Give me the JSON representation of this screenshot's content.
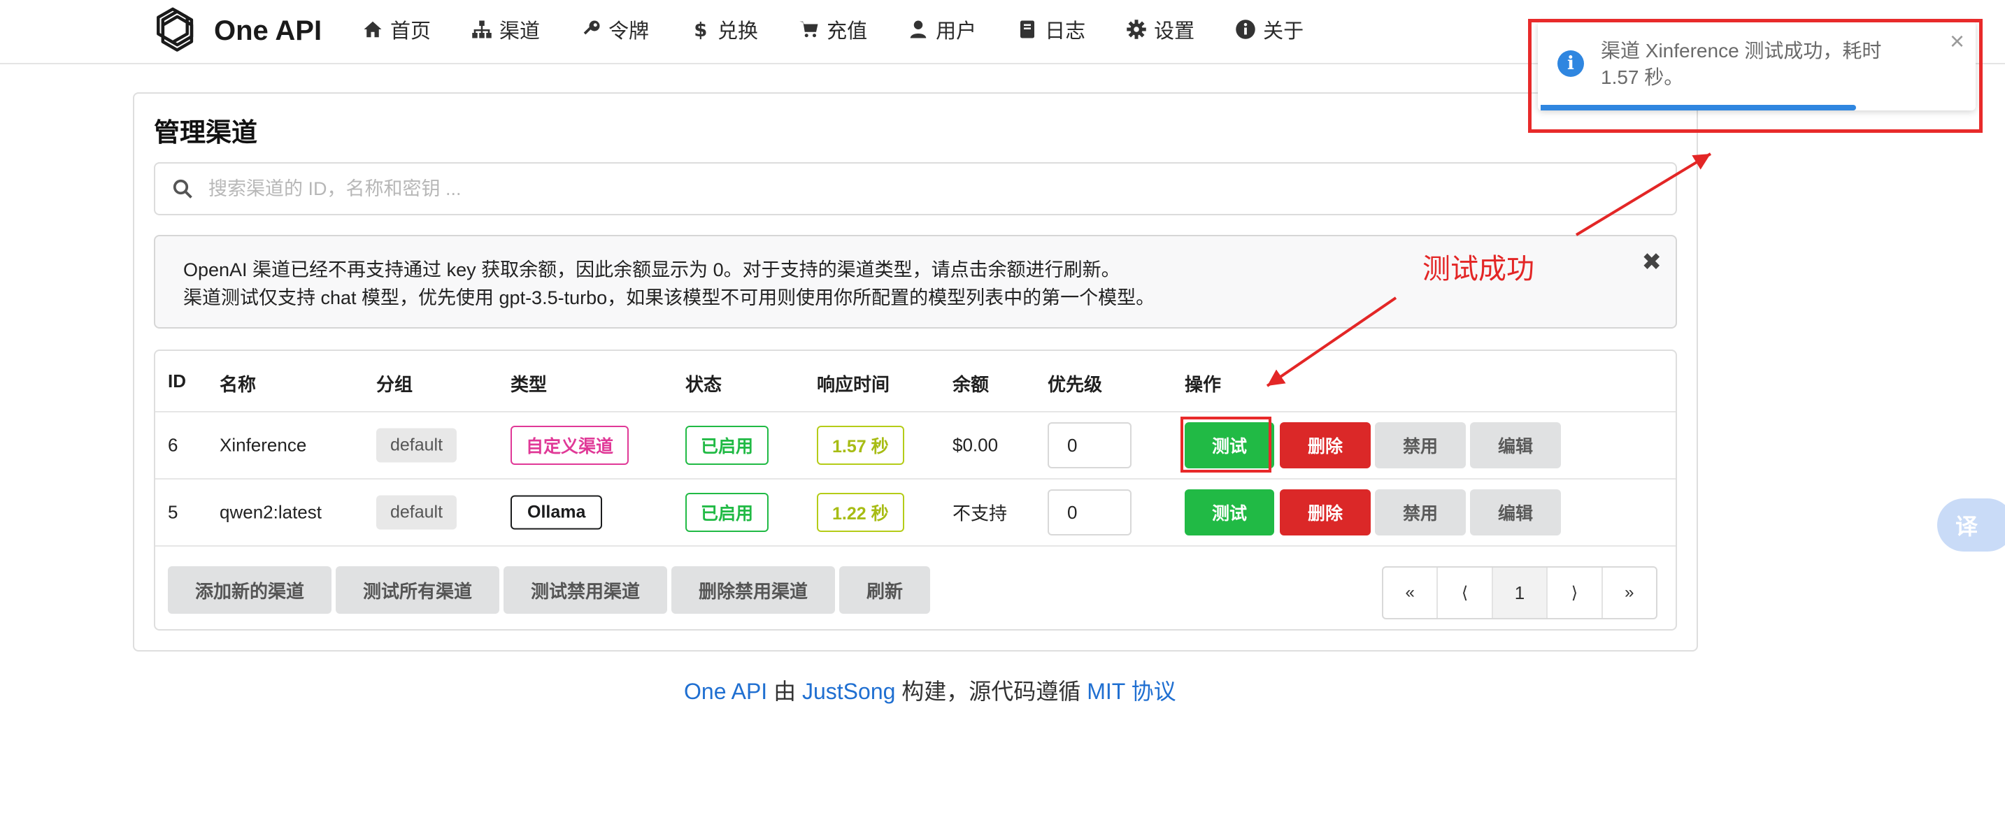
{
  "nav": {
    "brand": "One API",
    "items": [
      {
        "label": "首页",
        "icon": "home-icon"
      },
      {
        "label": "渠道",
        "icon": "sitemap-icon"
      },
      {
        "label": "令牌",
        "icon": "key-icon"
      },
      {
        "label": "兑换",
        "icon": "dollar-icon"
      },
      {
        "label": "充值",
        "icon": "cart-icon"
      },
      {
        "label": "用户",
        "icon": "user-icon"
      },
      {
        "label": "日志",
        "icon": "book-icon"
      },
      {
        "label": "设置",
        "icon": "gear-icon"
      },
      {
        "label": "关于",
        "icon": "info-icon"
      }
    ]
  },
  "page": {
    "title": "管理渠道",
    "search_placeholder": "搜索渠道的 ID，名称和密钥 ..."
  },
  "notice": {
    "line1": "OpenAI 渠道已经不再支持通过 key 获取余额，因此余额显示为 0。对于支持的渠道类型，请点击余额进行刷新。",
    "line2": "渠道测试仅支持 chat 模型，优先使用 gpt-3.5-turbo，如果该模型不可用则使用你所配置的模型列表中的第一个模型。",
    "close": "✖"
  },
  "table": {
    "headers": [
      "ID",
      "名称",
      "分组",
      "类型",
      "状态",
      "响应时间",
      "余额",
      "优先级",
      "操作"
    ],
    "rows": [
      {
        "id": "6",
        "name": "Xinference",
        "group": "default",
        "type": "自定义渠道",
        "status": "已启用",
        "response": "1.57 秒",
        "balance": "$0.00",
        "priority": "0"
      },
      {
        "id": "5",
        "name": "qwen2:latest",
        "group": "default",
        "type": "Ollama",
        "status": "已启用",
        "response": "1.22 秒",
        "balance": "不支持",
        "priority": "0"
      }
    ],
    "actions": {
      "test": "测试",
      "delete": "删除",
      "disable": "禁用",
      "edit": "编辑"
    }
  },
  "bottom_buttons": {
    "add": "添加新的渠道",
    "test_all": "测试所有渠道",
    "test_disabled": "测试禁用渠道",
    "delete_disabled": "删除禁用渠道",
    "refresh": "刷新"
  },
  "pagination": {
    "first": "«",
    "prev": "⟨",
    "current": "1",
    "next": "⟩",
    "last": "»"
  },
  "footer": {
    "app": "One API",
    "by": "由",
    "author": "JustSong",
    "built": "构建，源代码遵循",
    "license": "MIT 协议"
  },
  "toast": {
    "icon": "i",
    "message": "渠道 Xinference 测试成功，耗时 1.57 秒。",
    "close": "×",
    "progress": 0.72
  },
  "annotation": {
    "label": "测试成功"
  },
  "translate": {
    "label": "译"
  },
  "colors": {
    "accent_blue": "#2f86e0",
    "success_green": "#21ba45",
    "danger_red": "#db2828",
    "annotation_red": "#e82a2a"
  }
}
